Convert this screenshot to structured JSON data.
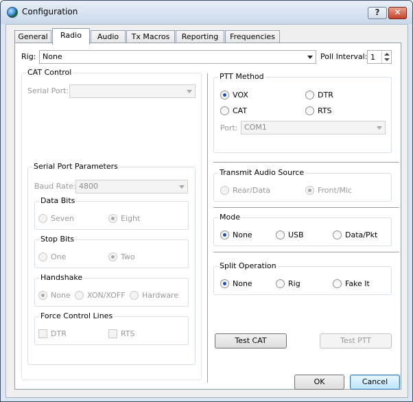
{
  "window": {
    "title": "Configuration",
    "help_label": "?",
    "close_label": "✕"
  },
  "tabs": [
    {
      "label": "General"
    },
    {
      "label": "Radio"
    },
    {
      "label": "Audio"
    },
    {
      "label": "Tx Macros"
    },
    {
      "label": "Reporting"
    },
    {
      "label": "Frequencies"
    }
  ],
  "active_tab": "Radio",
  "rig": {
    "label": "Rig:",
    "value": "None"
  },
  "poll": {
    "label": "Poll Interval:",
    "value": "1"
  },
  "cat_control": {
    "title": "CAT Control",
    "serial_port_label": "Serial Port:",
    "serial_port_value": ""
  },
  "serial_params": {
    "title": "Serial Port Parameters",
    "baud_label": "Baud Rate:",
    "baud_value": "4800",
    "data_bits": {
      "title": "Data Bits",
      "options": [
        "Seven",
        "Eight"
      ],
      "selected": "Eight"
    },
    "stop_bits": {
      "title": "Stop Bits",
      "options": [
        "One",
        "Two"
      ],
      "selected": "Two"
    },
    "handshake": {
      "title": "Handshake",
      "options": [
        "None",
        "XON/XOFF",
        "Hardware"
      ],
      "selected": "None"
    },
    "force_lines": {
      "title": "Force Control Lines",
      "options": [
        "DTR",
        "RTS"
      ]
    }
  },
  "ptt": {
    "title": "PTT Method",
    "options": [
      "VOX",
      "DTR",
      "CAT",
      "RTS"
    ],
    "selected": "VOX",
    "port_label": "Port:",
    "port_value": "COM1"
  },
  "tx_audio": {
    "title": "Transmit Audio Source",
    "options": [
      "Rear/Data",
      "Front/Mic"
    ],
    "selected": "Front/Mic"
  },
  "mode": {
    "title": "Mode",
    "options": [
      "None",
      "USB",
      "Data/Pkt"
    ],
    "selected": "None"
  },
  "split": {
    "title": "Split Operation",
    "options": [
      "None",
      "Rig",
      "Fake It"
    ],
    "selected": "None"
  },
  "buttons": {
    "test_cat": "Test CAT",
    "test_ptt": "Test PTT",
    "ok": "OK",
    "cancel": "Cancel"
  },
  "colors": {
    "radio_selected": "#1a4fb8",
    "title_bar": "#c9d8ea",
    "cancel_accent": "#3c7fb1"
  }
}
